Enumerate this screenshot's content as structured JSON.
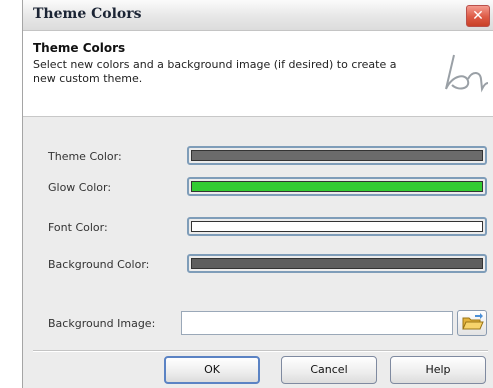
{
  "window": {
    "title": "Theme Colors",
    "close_glyph": "✕"
  },
  "header": {
    "title": "Theme Colors",
    "description": "Select new colors and a background image (if desired) to create a new custom theme.",
    "logo_icon": "bn-logo-icon"
  },
  "fields": {
    "theme_color": {
      "label": "Theme Color:",
      "color": "#6b6b6b"
    },
    "glow_color": {
      "label": "Glow Color:",
      "color": "#33cc33"
    },
    "font_color": {
      "label": "Font Color:",
      "color": "#ffffff"
    },
    "background_color": {
      "label": "Background Color:",
      "color": "#5e5e5e"
    },
    "background_image": {
      "label": "Background Image:",
      "value": "",
      "browse_icon": "folder-open-icon"
    }
  },
  "buttons": {
    "ok": "OK",
    "cancel": "Cancel",
    "help": "Help"
  },
  "colors": {
    "accent_border": "#7f9db9",
    "close_red": "#dd5a45"
  }
}
